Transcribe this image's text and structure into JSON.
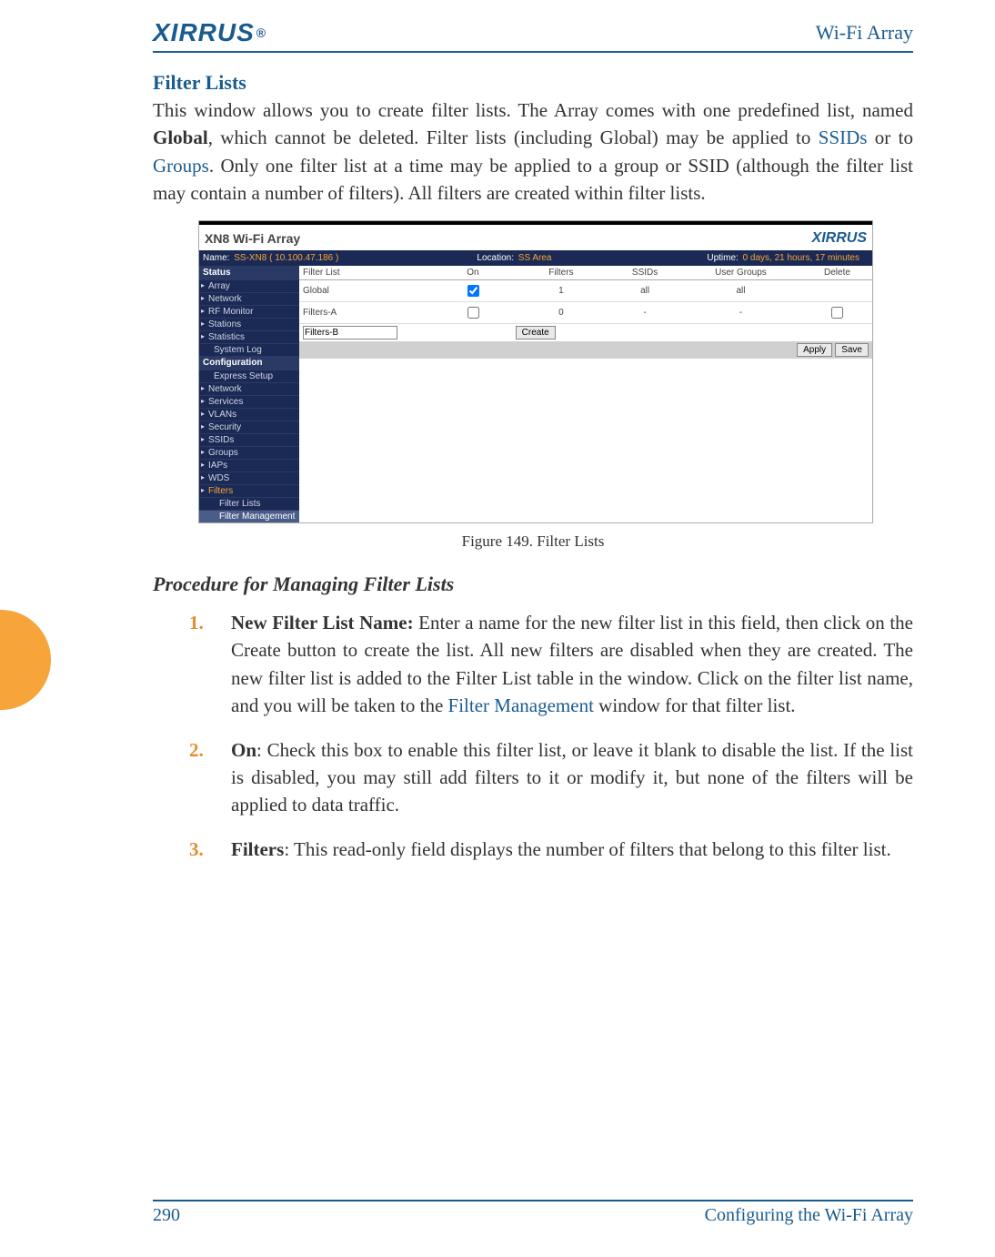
{
  "header": {
    "logo": "XIRRUS",
    "reg": "®",
    "right": "Wi-Fi Array"
  },
  "section": {
    "title": "Filter Lists"
  },
  "intro": {
    "p1a": "This window allows you to create filter lists. The Array comes with one predefined list, named ",
    "p1b": "Global",
    "p1c": ", which cannot be deleted. Filter lists (including Global) may be applied to ",
    "link1": "SSIDs",
    "p1d": " or to ",
    "link2": "Groups",
    "p1e": ". Only one filter list at a time may be applied to a group or SSID (although the filter list may contain a number of filters). All filters are created within filter lists."
  },
  "figure": {
    "caption": "Figure 149. Filter Lists"
  },
  "shot": {
    "title": "XN8 Wi-Fi Array",
    "brand": "XIRRUS",
    "status": {
      "name_l": "Name:",
      "name_v": "SS-XN8   ( 10.100.47.186 )",
      "loc_l": "Location:",
      "loc_v": "SS Area",
      "up_l": "Uptime:",
      "up_v": "0 days, 21 hours, 17 minutes"
    },
    "side": {
      "grp1": "Status",
      "items1": [
        "Array",
        "Network",
        "RF Monitor",
        "Stations",
        "Statistics",
        "System Log"
      ],
      "grp2": "Configuration",
      "items2": [
        "Express Setup",
        "Network",
        "Services",
        "VLANs",
        "Security",
        "SSIDs",
        "Groups",
        "IAPs",
        "WDS",
        "Filters"
      ],
      "sub": [
        "Filter Lists",
        "Filter Management"
      ]
    },
    "table": {
      "headers": [
        "Filter List",
        "On",
        "Filters",
        "SSIDs",
        "User Groups",
        "Delete"
      ],
      "rows": [
        {
          "name": "Global",
          "on": true,
          "filters": "1",
          "ssids": "all",
          "groups": "all",
          "del": ""
        },
        {
          "name": "Filters-A",
          "on": false,
          "filters": "0",
          "ssids": "-",
          "groups": "-",
          "del": false
        }
      ],
      "new": {
        "value": "Filters-B",
        "create": "Create"
      },
      "apply": "Apply",
      "save": "Save"
    }
  },
  "procedure": {
    "title": "Procedure for Managing Filter Lists",
    "steps": [
      {
        "lead": "New Filter List Name:",
        "body1": " Enter a name for the new filter list in this field, then click on the Create button to create the list. All new filters are disabled when they are created. The new filter list is added to the Filter List table in the window. Click on the filter list name, and you will be taken to the ",
        "link": "Filter Management",
        "body2": " window for that filter list."
      },
      {
        "lead": "On",
        "body1": ": Check this box to enable this filter list, or leave it blank to disable the list. If the list is disabled, you may still add filters to it or modify it, but none of the filters will be applied to data traffic.",
        "link": "",
        "body2": ""
      },
      {
        "lead": "Filters",
        "body1": ": This read-only field displays the number of filters that belong to this filter list.",
        "link": "",
        "body2": ""
      }
    ]
  },
  "footer": {
    "page": "290",
    "text": "Configuring the Wi-Fi Array"
  }
}
